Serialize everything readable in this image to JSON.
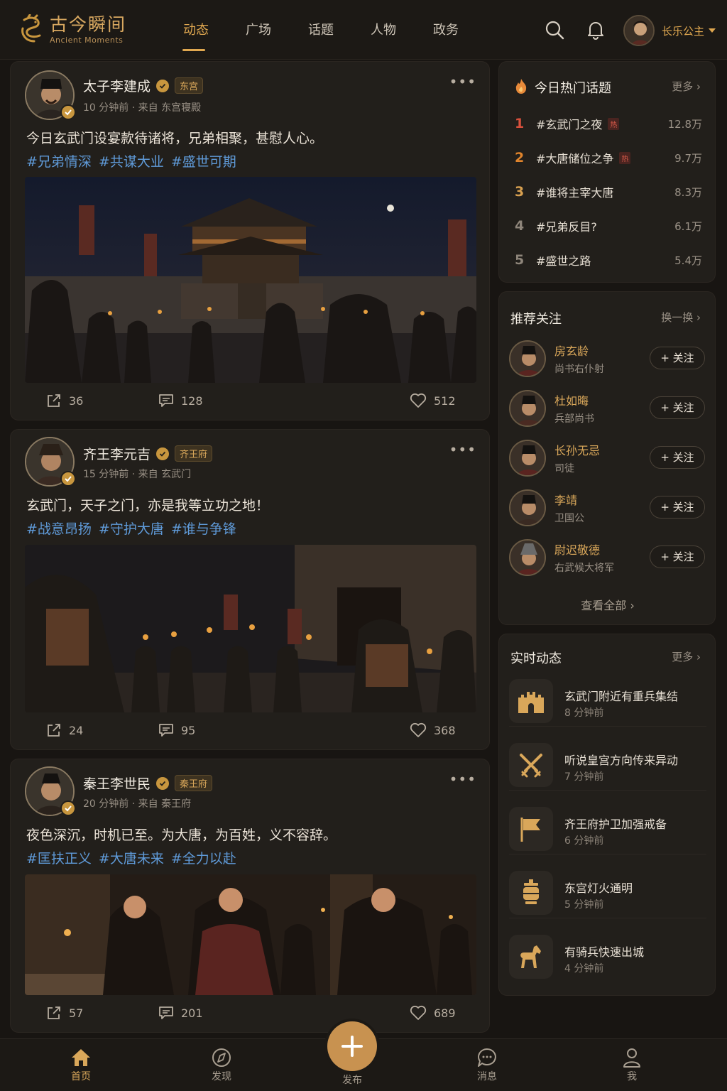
{
  "app": {
    "logo_cn": "古今瞬间",
    "logo_en": "Ancient Moments",
    "accent_color": "#e0a850"
  },
  "nav": [
    {
      "label": "动态",
      "active": true
    },
    {
      "label": "广场"
    },
    {
      "label": "话题"
    },
    {
      "label": "人物"
    },
    {
      "label": "政务"
    }
  ],
  "header": {
    "search_icon": "search-icon",
    "bell_icon": "bell-icon",
    "user_name": "长乐公主"
  },
  "posts": [
    {
      "author": "太子李建成",
      "tag": "东宫",
      "meta": "10 分钟前 · 来自 东宫寝殿",
      "text": "今日玄武门设宴款待诸将，兄弟相聚，甚慰人心。",
      "hashtags": [
        "#兄弟情深",
        "#共谋大业",
        "#盛世可期"
      ],
      "shares": "36",
      "comments": "128",
      "likes": "512",
      "image": "palace-gate-night-scene"
    },
    {
      "author": "齐王李元吉",
      "tag": "齐王府",
      "meta": "15 分钟前 · 来自 玄武门",
      "text": "玄武门，天子之门，亦是我等立功之地！",
      "hashtags": [
        "#战意昂扬",
        "#守护大唐",
        "#谁与争锋"
      ],
      "shares": "24",
      "comments": "95",
      "likes": "368",
      "image": "armored-soldiers-at-gate"
    },
    {
      "author": "秦王李世民",
      "tag": "秦王府",
      "meta": "20 分钟前 · 来自 秦王府",
      "text": "夜色深沉，时机已至。为大唐，为百姓，义不容辞。",
      "hashtags": [
        "#匡扶正义",
        "#大唐未来",
        "#全力以赴"
      ],
      "shares": "57",
      "comments": "201",
      "likes": "689",
      "image": "council-in-candlelit-hall"
    }
  ],
  "hot_topics": {
    "title": "今日热门话题",
    "more": "更多",
    "items": [
      {
        "rank": "1",
        "name": "#玄武门之夜",
        "badge": "热",
        "count": "12.8万"
      },
      {
        "rank": "2",
        "name": "#大唐储位之争",
        "badge": "热",
        "count": "9.7万"
      },
      {
        "rank": "3",
        "name": "#谁将主宰大唐",
        "badge": "",
        "count": "8.3万"
      },
      {
        "rank": "4",
        "name": "#兄弟反目?",
        "badge": "",
        "count": "6.1万"
      },
      {
        "rank": "5",
        "name": "#盛世之路",
        "badge": "",
        "count": "5.4万"
      }
    ]
  },
  "recommend": {
    "title": "推荐关注",
    "refresh": "换一换",
    "follow_label": "+ 关注",
    "view_all": "查看全部",
    "items": [
      {
        "name": "房玄龄",
        "title": "尚书右仆射"
      },
      {
        "name": "杜如晦",
        "title": "兵部尚书"
      },
      {
        "name": "长孙无忌",
        "title": "司徒"
      },
      {
        "name": "李靖",
        "title": "卫国公"
      },
      {
        "name": "尉迟敬德",
        "title": "右武候大将军"
      }
    ]
  },
  "live": {
    "title": "实时动态",
    "more": "更多",
    "items": [
      {
        "icon": "fortress-icon",
        "text": "玄武门附近有重兵集结",
        "time": "8 分钟前"
      },
      {
        "icon": "crossed-swords-icon",
        "text": "听说皇宫方向传来异动",
        "time": "7 分钟前"
      },
      {
        "icon": "flag-icon",
        "text": "齐王府护卫加强戒备",
        "time": "6 分钟前"
      },
      {
        "icon": "lantern-icon",
        "text": "东宫灯火通明",
        "time": "5 分钟前"
      },
      {
        "icon": "horse-icon",
        "text": "有骑兵快速出城",
        "time": "4 分钟前"
      }
    ]
  },
  "tabbar": {
    "home": "首页",
    "discover": "发现",
    "publish": "发布",
    "messages": "消息",
    "me": "我"
  }
}
